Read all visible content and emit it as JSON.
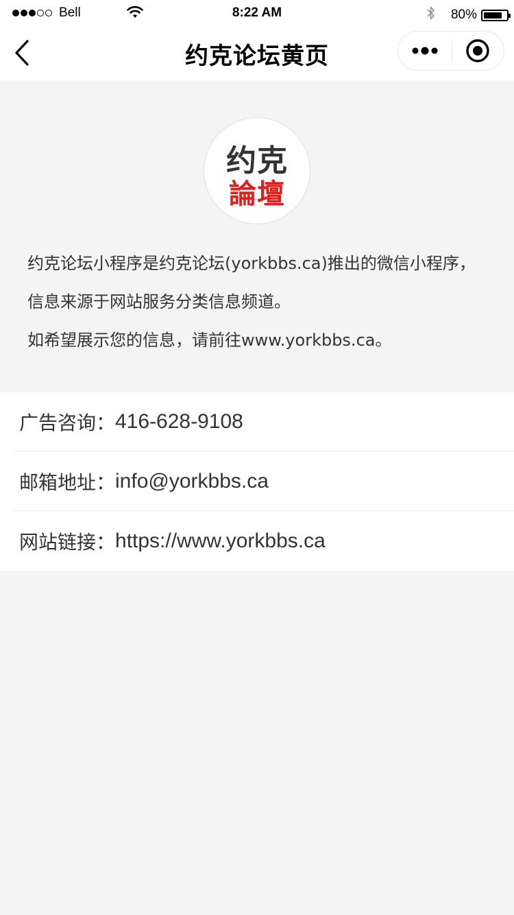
{
  "status_bar": {
    "carrier": "Bell",
    "time": "8:22 AM",
    "battery_percent": "80%",
    "battery_level": 0.8,
    "signal_bars_filled": 3,
    "signal_bars_total": 5
  },
  "nav": {
    "title": "约克论坛黄页"
  },
  "logo": {
    "line1": "约克",
    "line2": "論壇",
    "line2_color": "#e02020"
  },
  "intro": {
    "lines": [
      "约克论坛小程序是约克论坛(yorkbbs.ca)推出的微信小程序，",
      "信息来源于网站服务分类信息频道。",
      "如希望展示您的信息，请前往www.yorkbbs.ca。"
    ]
  },
  "info": {
    "rows": [
      {
        "label": "广告咨询：",
        "value": "416-628-9108"
      },
      {
        "label": "邮箱地址：",
        "value": "info@yorkbbs.ca"
      },
      {
        "label": "网站链接：",
        "value": "https://www.yorkbbs.ca"
      }
    ]
  },
  "colors": {
    "background": "#f4f4f4",
    "surface": "#ffffff",
    "accent_red": "#e02020",
    "text": "#333333"
  },
  "icons": {
    "back": "chevron-left-icon",
    "more": "more-dots-icon",
    "close": "target-circle-icon",
    "wifi": "wifi-icon",
    "bluetooth": "bluetooth-icon",
    "battery": "battery-icon"
  }
}
